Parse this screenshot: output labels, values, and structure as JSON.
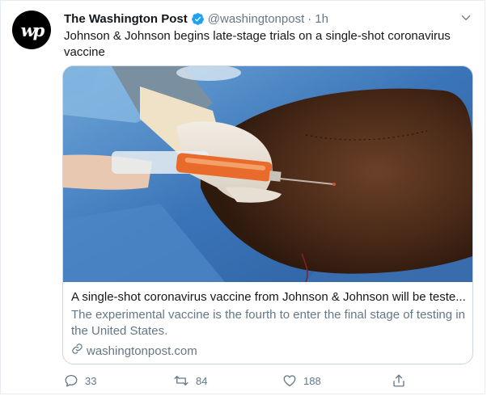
{
  "tweet": {
    "author": {
      "name": "The Washington Post",
      "handle": "@washingtonpost",
      "avatar_text": "wp",
      "verified": true
    },
    "separator": "·",
    "time": "1h",
    "text": "Johnson & Johnson begins late-stage trials on a single-shot coronavirus vaccine",
    "card": {
      "title": "A single-shot coronavirus vaccine from Johnson & Johnson will be teste...",
      "description": "The experimental vaccine is the fourth to enter the final stage of testing in the United States.",
      "domain": "washingtonpost.com"
    },
    "actions": {
      "replies": "33",
      "retweets": "84",
      "likes": "188"
    }
  },
  "colors": {
    "verified": "#1da1f2",
    "secondary_text": "#657786",
    "border": "#ccd6dd"
  },
  "icons": {
    "verified": "verified-badge-icon",
    "menu": "chevron-down-icon",
    "link": "link-icon",
    "reply": "reply-icon",
    "retweet": "retweet-icon",
    "like": "heart-icon",
    "share": "share-icon"
  }
}
